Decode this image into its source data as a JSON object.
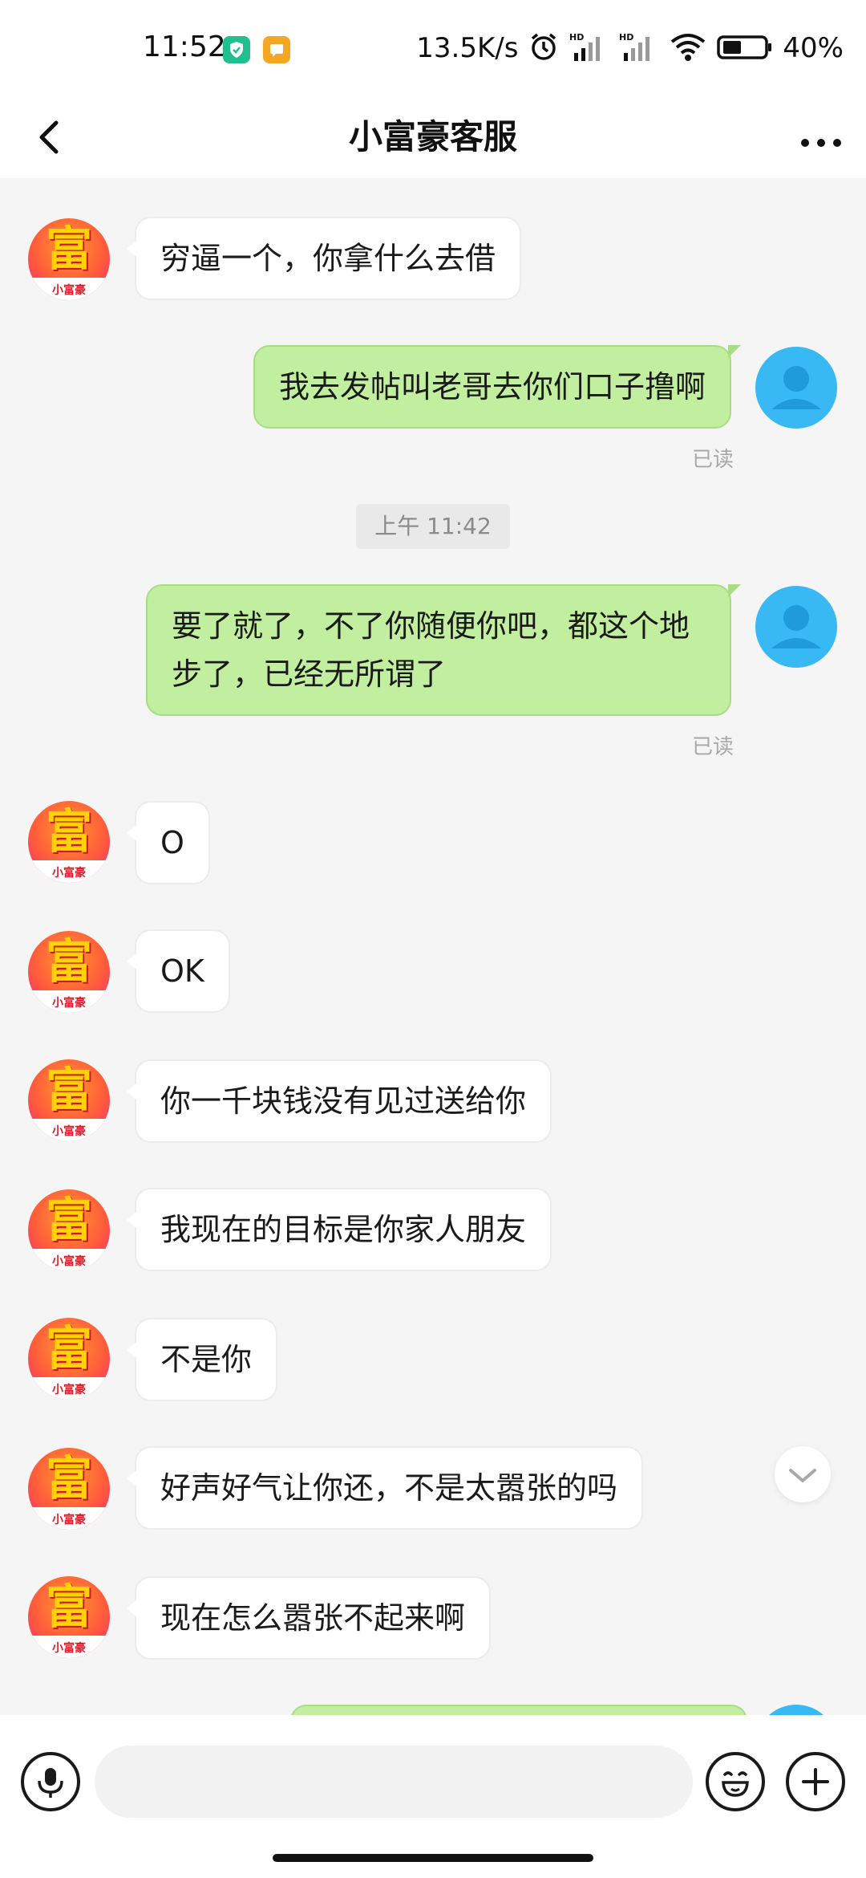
{
  "status_bar": {
    "time": "11:52",
    "net_speed": "13.5K/s",
    "battery": "40%",
    "icons": [
      "shield-app-icon",
      "message-app-icon",
      "alarm-icon",
      "hd-signal-icon",
      "hd-signal-icon",
      "wifi-icon",
      "battery-icon"
    ]
  },
  "header": {
    "title": "小富豪客服",
    "back_icon": "chevron-left-icon",
    "more_icon": "more-horizontal-icon"
  },
  "avatars": {
    "agent_glyph": "富",
    "agent_brand": "小富豪"
  },
  "messages": [
    {
      "side": "left",
      "text": "穷逼一个，你拿什么去借"
    },
    {
      "side": "right",
      "text": "我去发帖叫老哥去你们口子撸啊",
      "status": "已读"
    },
    {
      "type": "timestamp",
      "text": "上午 11:42"
    },
    {
      "side": "right",
      "text": "要了就了，不了你随便你吧，都这个地步了，已经无所谓了",
      "status": "已读"
    },
    {
      "side": "left",
      "text": "O"
    },
    {
      "side": "left",
      "text": "OK"
    },
    {
      "side": "left",
      "text": "你一千块钱没有见过送给你"
    },
    {
      "side": "left",
      "text": "我现在的目标是你家人朋友"
    },
    {
      "side": "left",
      "text": "不是你"
    },
    {
      "side": "left",
      "text": "好声好气让你还，不是太嚣张的吗"
    },
    {
      "side": "left",
      "text": "现在怎么嚣张不起来啊"
    }
  ],
  "input_bar": {
    "placeholder": "",
    "value": "",
    "voice_icon": "microphone-icon",
    "emoji_icon": "smiley-icon",
    "plus_icon": "plus-icon"
  },
  "colors": {
    "sent_bubble": "#c2eea0",
    "received_bubble": "#ffffff",
    "user_avatar": "#38b9f3",
    "chat_background": "#f5f5f5"
  }
}
